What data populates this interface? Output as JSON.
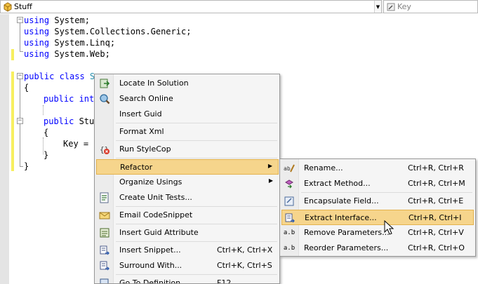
{
  "navbar": {
    "type_combo": {
      "label": "Stuff",
      "icon": "class-icon"
    },
    "member_combo": {
      "label": "Key",
      "icon": "property-icon"
    }
  },
  "code": {
    "lines": [
      {
        "keyword": "using",
        "rest": " System;"
      },
      {
        "keyword": "using",
        "rest": " System.Collections.Generic;"
      },
      {
        "keyword": "using",
        "rest": " System.Linq;"
      },
      {
        "keyword": "using",
        "rest": " System.Web;"
      },
      {
        "keyword": "public class",
        "rest": " S"
      },
      {
        "keyword": "",
        "rest": "{"
      },
      {
        "keyword": "public int",
        "rest": ""
      },
      {
        "keyword": "public",
        "rest": " Stu"
      },
      {
        "keyword": "",
        "rest": "{"
      },
      {
        "keyword": "",
        "rest": "Key = "
      },
      {
        "keyword": "",
        "rest": "}"
      },
      {
        "keyword": "",
        "rest": "}"
      }
    ]
  },
  "context_menu": {
    "items": [
      {
        "label": "Locate In Solution",
        "shortcut": "",
        "icon": "locate-solution-icon"
      },
      {
        "label": "Search Online",
        "shortcut": "",
        "icon": "search-online-icon"
      },
      {
        "label": "Insert Guid",
        "shortcut": "",
        "icon": ""
      },
      {
        "label": "Format Xml",
        "shortcut": "",
        "icon": ""
      },
      {
        "label": "Run StyleCop",
        "shortcut": "",
        "icon": "stylecop-icon"
      },
      {
        "label": "Refactor",
        "shortcut": "",
        "icon": "",
        "submenu": true
      },
      {
        "label": "Organize Usings",
        "shortcut": "",
        "icon": "",
        "submenu": true
      },
      {
        "label": "Create Unit Tests...",
        "shortcut": "",
        "icon": "unit-test-icon"
      },
      {
        "label": "Email CodeSnippet",
        "shortcut": "",
        "icon": "email-icon"
      },
      {
        "label": "Insert Guid Attribute",
        "shortcut": "",
        "icon": "guid-attribute-icon"
      },
      {
        "label": "Insert Snippet...",
        "shortcut": "Ctrl+K, Ctrl+X",
        "icon": "insert-snippet-icon"
      },
      {
        "label": "Surround With...",
        "shortcut": "Ctrl+K, Ctrl+S",
        "icon": "surround-with-icon"
      },
      {
        "label": "Go To Definition",
        "shortcut": "F12",
        "icon": "go-to-definition-icon"
      }
    ],
    "highlighted": "Refactor"
  },
  "refactor_submenu": {
    "items": [
      {
        "label": "Rename...",
        "shortcut": "Ctrl+R, Ctrl+R",
        "icon": "rename-icon"
      },
      {
        "label": "Extract Method...",
        "shortcut": "Ctrl+R, Ctrl+M",
        "icon": "extract-method-icon"
      },
      {
        "label": "Encapsulate Field...",
        "shortcut": "Ctrl+R, Ctrl+E",
        "icon": "encapsulate-field-icon"
      },
      {
        "label": "Extract Interface...",
        "shortcut": "Ctrl+R, Ctrl+I",
        "icon": "extract-interface-icon"
      },
      {
        "label": "Remove Parameters...",
        "shortcut": "Ctrl+R, Ctrl+V",
        "icon": "remove-parameters-icon"
      },
      {
        "label": "Reorder Parameters...",
        "shortcut": "Ctrl+R, Ctrl+O",
        "icon": "reorder-parameters-icon"
      }
    ],
    "highlighted": "Extract Interface..."
  },
  "colors": {
    "keyword": "#0000ff",
    "highlight": "#f6d58c",
    "change_bar": "#f7ef5f"
  }
}
